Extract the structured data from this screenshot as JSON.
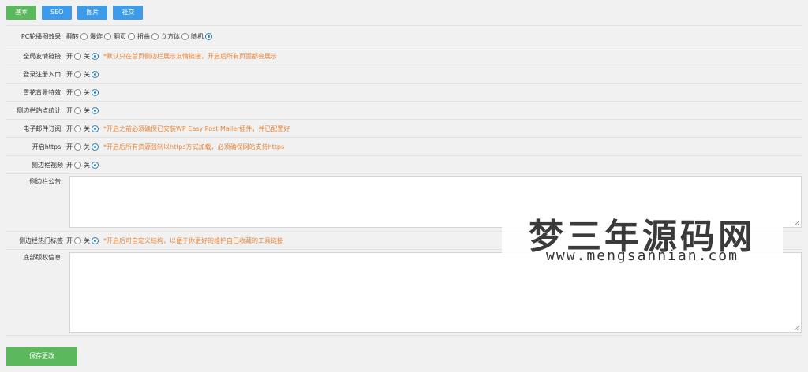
{
  "tabs": [
    "基本",
    "SEO",
    "图片",
    "社交"
  ],
  "rows": {
    "carousel": {
      "label": "PC轮播图效果:",
      "options": [
        "翻转",
        "爆炸",
        "翻页",
        "扭曲",
        "立方体",
        "随机"
      ]
    },
    "friendlinks": {
      "label": "全局友情链接:",
      "on": "开",
      "off": "关",
      "note": "*默认只在首页侧边栏展示友情链接，开启后所有页面都会展示"
    },
    "register": {
      "label": "登录注册入口:",
      "on": "开",
      "off": "关"
    },
    "snow": {
      "label": "雪花背景特效:",
      "on": "开",
      "off": "关"
    },
    "stats": {
      "label": "侧边栏站点统计:",
      "on": "开",
      "off": "关"
    },
    "email": {
      "label": "电子邮件订阅:",
      "on": "开",
      "off": "关",
      "note": "*开启之前必须确保已安装WP Easy Post Mailer插件，并已配置好"
    },
    "https": {
      "label": "开启https:",
      "on": "开",
      "off": "关",
      "note": "*开启后所有资源强制以https方式加载，必须确保网站支持https"
    },
    "video": {
      "label": "侧边栏视频",
      "on": "开",
      "off": "关"
    },
    "notice": {
      "label": "侧边栏公告:",
      "value": ""
    },
    "tags": {
      "label": "侧边栏热门标签",
      "on": "开",
      "off": "关",
      "note": "*开启后可自定义结构，以便于你更好的维护自己收藏的工具链接"
    },
    "copyright": {
      "label": "底部版权信息:",
      "value": ""
    }
  },
  "save_label": "保存更改",
  "watermark": {
    "title": "梦三年源码网",
    "url": "www.mengsannian.com"
  }
}
